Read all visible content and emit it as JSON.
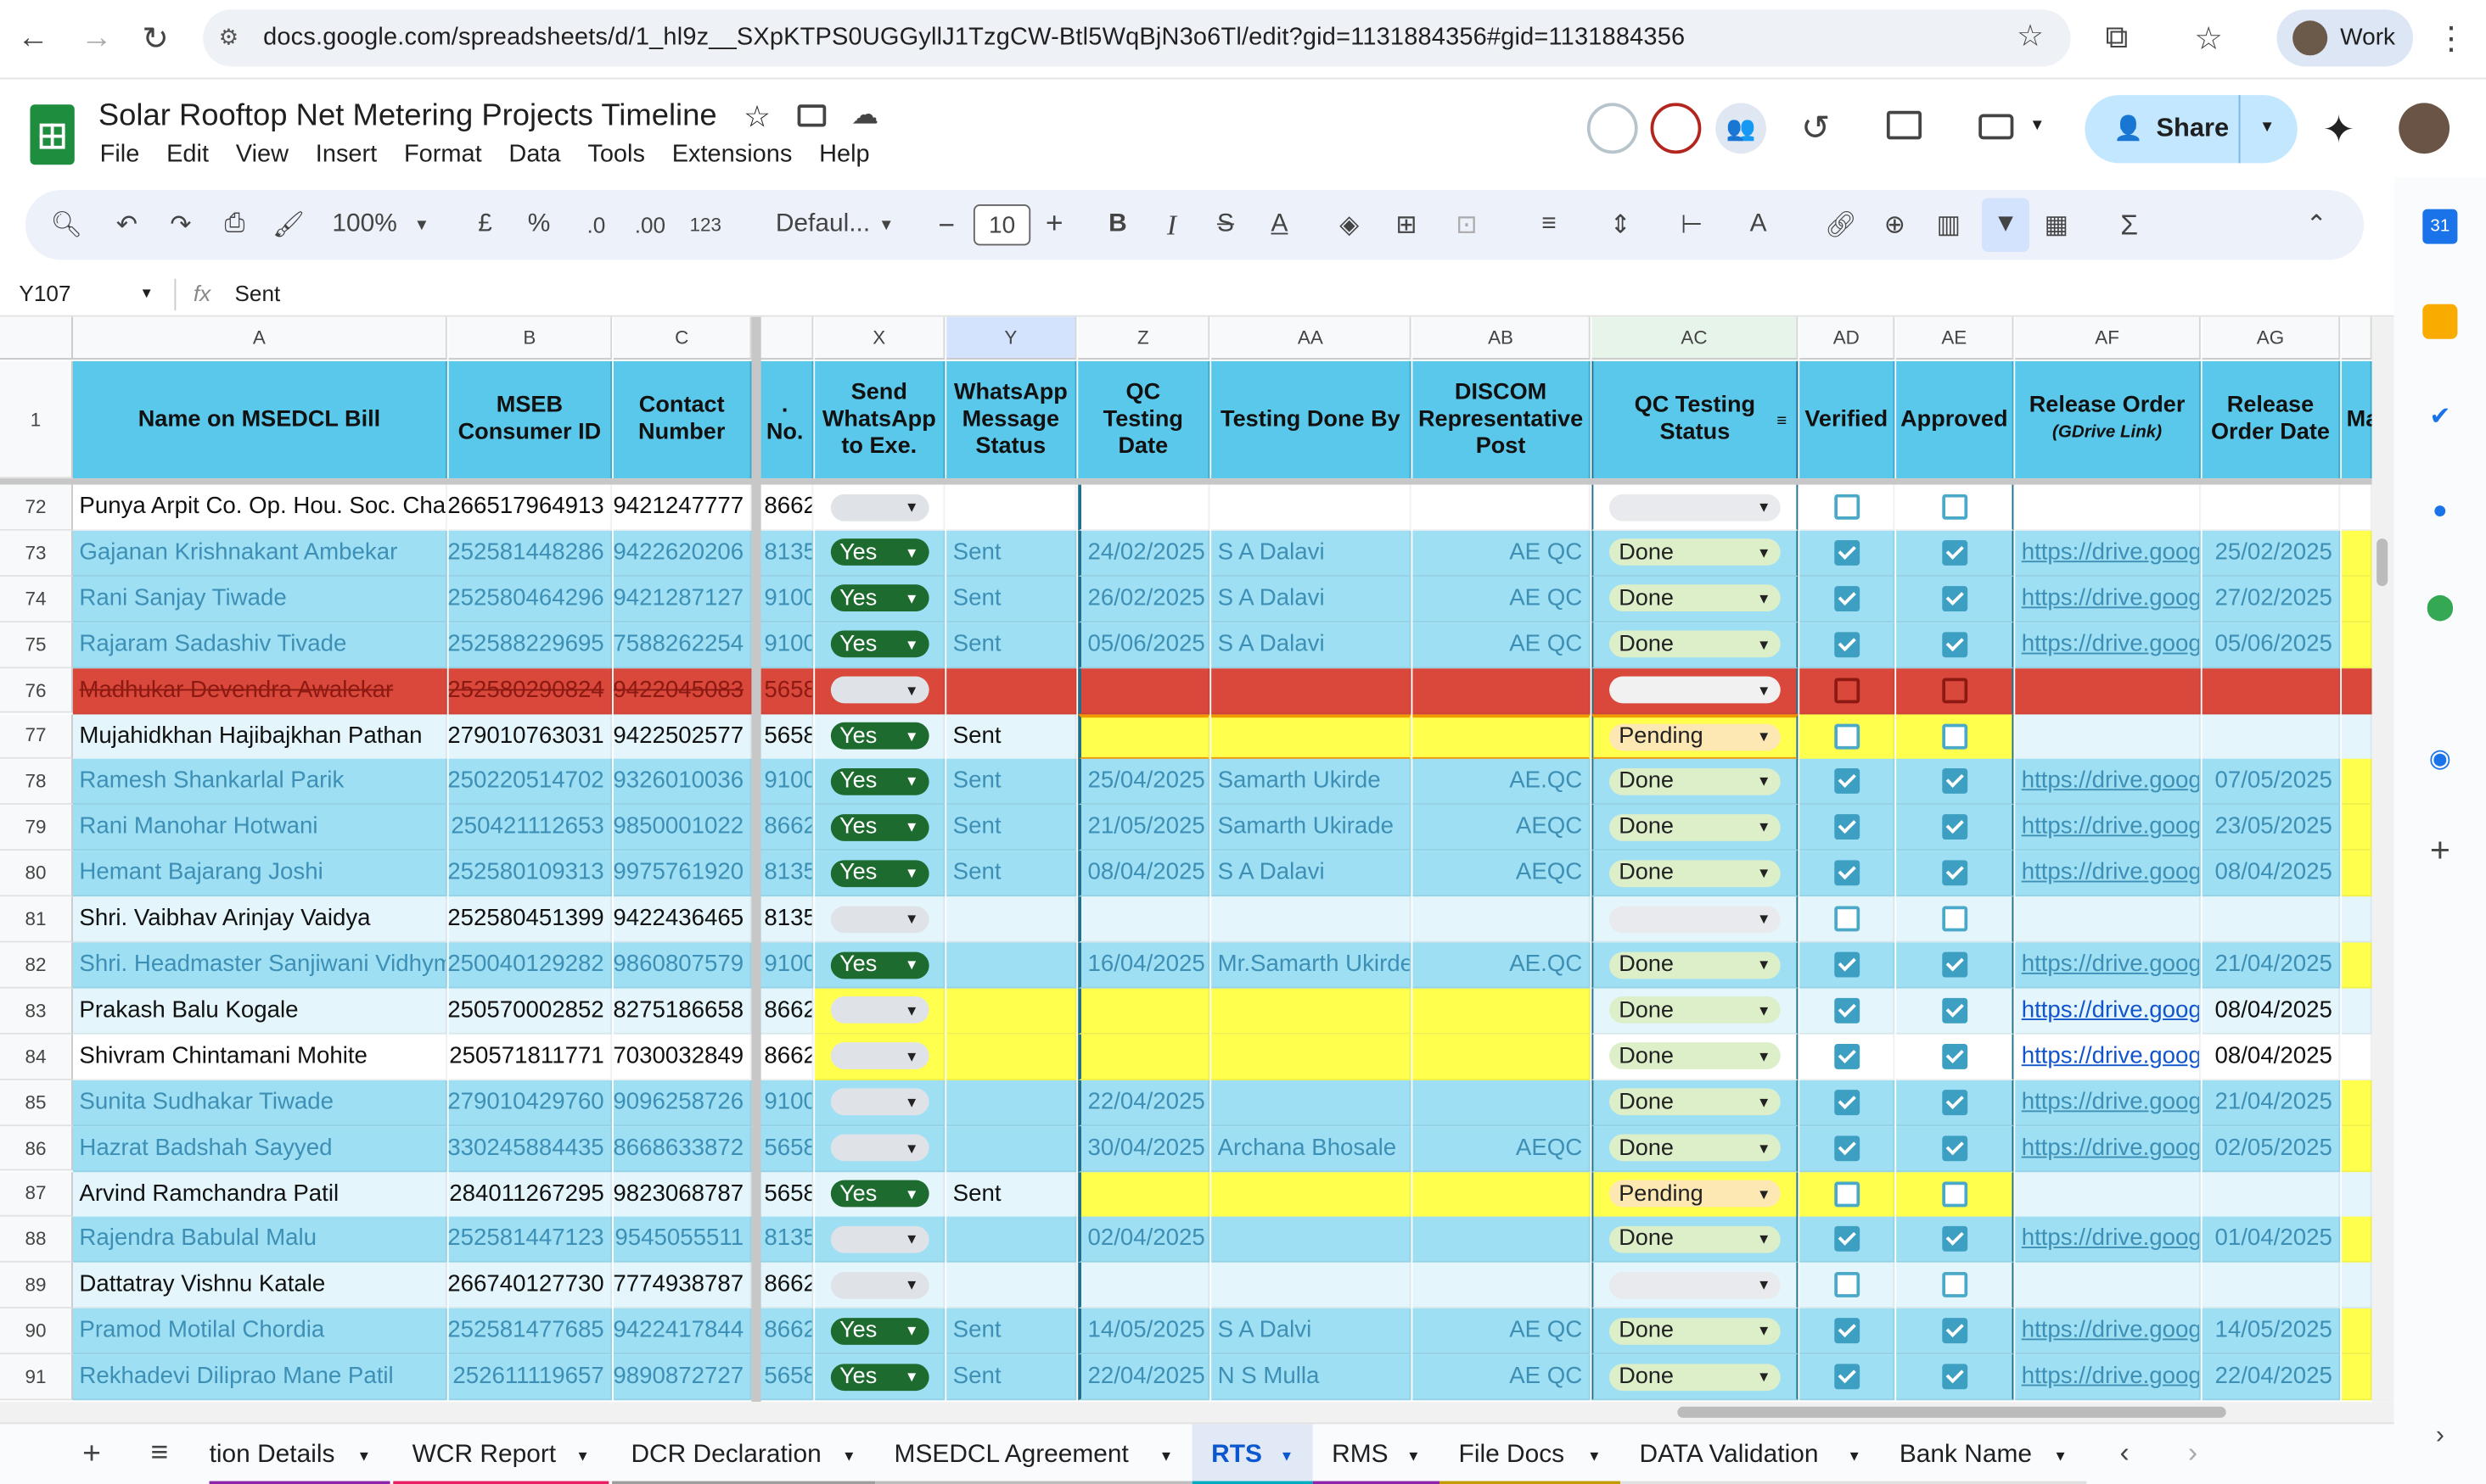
{
  "browser": {
    "url": "docs.google.com/spreadsheets/d/1_hl9z__SXpKTPS0UGGyllJ1TzgCW-Btl5WqBjN3o6Tl/edit?gid=1131884356#gid=1131884356",
    "profile_label": "Work"
  },
  "doc": {
    "title": "Solar Rooftop Net Metering Projects Timeline",
    "menu": [
      "File",
      "Edit",
      "View",
      "Insert",
      "Format",
      "Data",
      "Tools",
      "Extensions",
      "Help"
    ],
    "share_label": "Share"
  },
  "toolbar": {
    "zoom": "100%",
    "currency": "£",
    "percent": "%",
    "dec_decrease": ".0",
    "dec_increase": ".00",
    "format_123": "123",
    "font": "Defaul...",
    "font_size": "10",
    "minus": "−",
    "plus": "+"
  },
  "formula_bar": {
    "name_box": "Y107",
    "fx": "fx",
    "content": "Sent"
  },
  "columns": [
    "A",
    "B",
    "C",
    "X",
    "Y",
    "Z",
    "AA",
    "AB",
    "AC",
    "AD",
    "AE",
    "AF",
    "AG"
  ],
  "headers": {
    "A": "Name on MSEDCL Bill",
    "B": "MSEB Consumer ID",
    "C": "Contact Number",
    "partial": ". No.",
    "X": "Send WhatsApp to Exe.",
    "Y": "WhatsApp Message Status",
    "Z": "QC Testing Date",
    "AA": "Testing Done By",
    "AB": "DISCOM Representative Post",
    "AC": "QC Testing Status",
    "AD": "Verified",
    "AE": "Approved",
    "AF": "Release Order",
    "AF_sub": "(GDrive Link)",
    "AG": "Release Order Date",
    "AH_partial": "Ma"
  },
  "rows": [
    {
      "n": "72",
      "name": "Punya Arpit Co. Op. Hou. Soc. Chair",
      "consumer": "266517964913",
      "contact": "9421247777",
      "sno": "8662",
      "wa": "",
      "wa_status": "",
      "qc_date": "",
      "by": "",
      "post": "",
      "status": "",
      "verified": false,
      "approved": false,
      "link": "",
      "date": ""
    },
    {
      "n": "73",
      "name": "Gajanan Krishnakant Ambekar",
      "consumer": "252581448286",
      "contact": "9422620206",
      "sno": "8135",
      "wa": "Yes",
      "wa_status": "Sent",
      "qc_date": "24/02/2025",
      "by": "S A Dalavi",
      "post": "AE QC",
      "status": "Done",
      "verified": true,
      "approved": true,
      "link": "https://drive.googl",
      "date": "25/02/2025"
    },
    {
      "n": "74",
      "name": "Rani Sanjay Tiwade",
      "consumer": "252580464296",
      "contact": "9421287127",
      "sno": "9100",
      "wa": "Yes",
      "wa_status": "Sent",
      "qc_date": "26/02/2025",
      "by": "S A Dalavi",
      "post": "AE QC",
      "status": "Done",
      "verified": true,
      "approved": true,
      "link": "https://drive.googl",
      "date": "27/02/2025"
    },
    {
      "n": "75",
      "name": "Rajaram Sadashiv Tivade",
      "consumer": "252588229695",
      "contact": "7588262254",
      "sno": "9100",
      "wa": "Yes",
      "wa_status": "Sent",
      "qc_date": "05/06/2025",
      "by": "S A Dalavi",
      "post": "AE QC",
      "status": "Done",
      "verified": true,
      "approved": true,
      "link": "https://drive.googl",
      "date": "05/06/2025"
    },
    {
      "n": "76",
      "name": "Madhukar Devendra Awalekar",
      "consumer": "252580290824",
      "contact": "9422045083",
      "sno": "5658",
      "wa": "",
      "wa_status": "",
      "qc_date": "",
      "by": "",
      "post": "",
      "status": "",
      "verified": false,
      "approved": false,
      "link": "",
      "date": ""
    },
    {
      "n": "77",
      "name": "Mujahidkhan Hajibajkhan Pathan",
      "consumer": "279010763031",
      "contact": "9422502577",
      "sno": "5658",
      "wa": "Yes",
      "wa_status": "Sent",
      "qc_date": "",
      "by": "",
      "post": "",
      "status": "Pending",
      "verified": false,
      "approved": false,
      "link": "",
      "date": ""
    },
    {
      "n": "78",
      "name": "Ramesh Shankarlal Parik",
      "consumer": "250220514702",
      "contact": "9326010036",
      "sno": "9100",
      "wa": "Yes",
      "wa_status": "Sent",
      "qc_date": "25/04/2025",
      "by": "Samarth Ukirde",
      "post": "AE.QC",
      "status": "Done",
      "verified": true,
      "approved": true,
      "link": "https://drive.googl",
      "date": "07/05/2025"
    },
    {
      "n": "79",
      "name": "Rani Manohar Hotwani",
      "consumer": "250421112653",
      "contact": "9850001022",
      "sno": "8662",
      "wa": "Yes",
      "wa_status": "Sent",
      "qc_date": "21/05/2025",
      "by": "Samarth Ukirade",
      "post": "AEQC",
      "status": "Done",
      "verified": true,
      "approved": true,
      "link": "https://drive.googl",
      "date": "23/05/2025"
    },
    {
      "n": "80",
      "name": "Hemant Bajarang Joshi",
      "consumer": "252580109313",
      "contact": "9975761920",
      "sno": "8135",
      "wa": "Yes",
      "wa_status": "Sent",
      "qc_date": "08/04/2025",
      "by": "S A Dalavi",
      "post": "AEQC",
      "status": "Done",
      "verified": true,
      "approved": true,
      "link": "https://drive.googl",
      "date": "08/04/2025"
    },
    {
      "n": "81",
      "name": "Shri. Vaibhav Arinjay Vaidya",
      "consumer": "252580451399",
      "contact": "9422436465",
      "sno": "8135",
      "wa": "",
      "wa_status": "",
      "qc_date": "",
      "by": "",
      "post": "",
      "status": "",
      "verified": false,
      "approved": false,
      "link": "",
      "date": ""
    },
    {
      "n": "82",
      "name": "Shri. Headmaster Sanjiwani Vidhyma",
      "consumer": "250040129282",
      "contact": "9860807579",
      "sno": "9100",
      "wa": "Yes",
      "wa_status": "",
      "qc_date": "16/04/2025",
      "by": "Mr.Samarth Ukirde",
      "post": "AE.QC",
      "status": "Done",
      "verified": true,
      "approved": true,
      "link": "https://drive.googl",
      "date": "21/04/2025"
    },
    {
      "n": "83",
      "name": "Prakash Balu Kogale",
      "consumer": "250570002852",
      "contact": "8275186658",
      "sno": "8662",
      "wa": "",
      "wa_status": "",
      "qc_date": "",
      "by": "",
      "post": "",
      "status": "Done",
      "verified": true,
      "approved": true,
      "link": "https://drive.googl",
      "date": "08/04/2025"
    },
    {
      "n": "84",
      "name": "Shivram Chintamani Mohite",
      "consumer": "250571811771",
      "contact": "7030032849",
      "sno": "8662",
      "wa": "",
      "wa_status": "",
      "qc_date": "",
      "by": "",
      "post": "",
      "status": "Done",
      "verified": true,
      "approved": true,
      "link": "https://drive.googl",
      "date": "08/04/2025"
    },
    {
      "n": "85",
      "name": "Sunita Sudhakar Tiwade",
      "consumer": "279010429760",
      "contact": "9096258726",
      "sno": "9100",
      "wa": "",
      "wa_status": "",
      "qc_date": "22/04/2025",
      "by": "",
      "post": "",
      "status": "Done",
      "verified": true,
      "approved": true,
      "link": "https://drive.googl",
      "date": "21/04/2025"
    },
    {
      "n": "86",
      "name": "Hazrat Badshah Sayyed",
      "consumer": "330245884435",
      "contact": "8668633872",
      "sno": "5658",
      "wa": "",
      "wa_status": "",
      "qc_date": "30/04/2025",
      "by": "Archana Bhosale",
      "post": "AEQC",
      "status": "Done",
      "verified": true,
      "approved": true,
      "link": "https://drive.googl",
      "date": "02/05/2025"
    },
    {
      "n": "87",
      "name": "Arvind Ramchandra Patil",
      "consumer": "284011267295",
      "contact": "9823068787",
      "sno": "5658",
      "wa": "Yes",
      "wa_status": "Sent",
      "qc_date": "",
      "by": "",
      "post": "",
      "status": "Pending",
      "verified": false,
      "approved": false,
      "link": "",
      "date": ""
    },
    {
      "n": "88",
      "name": "Rajendra Babulal Malu",
      "consumer": "252581447123",
      "contact": "9545055511",
      "sno": "8135",
      "wa": "",
      "wa_status": "",
      "qc_date": "02/04/2025",
      "by": "",
      "post": "",
      "status": "Done",
      "verified": true,
      "approved": true,
      "link": "https://drive.googl",
      "date": "01/04/2025"
    },
    {
      "n": "89",
      "name": "Dattatray Vishnu Katale",
      "consumer": "266740127730",
      "contact": "7774938787",
      "sno": "8662",
      "wa": "",
      "wa_status": "",
      "qc_date": "",
      "by": "",
      "post": "",
      "status": "",
      "verified": false,
      "approved": false,
      "link": "",
      "date": ""
    },
    {
      "n": "90",
      "name": "Pramod Motilal Chordia",
      "consumer": "252581477685",
      "contact": "9422417844",
      "sno": "8662",
      "wa": "Yes",
      "wa_status": "Sent",
      "qc_date": "14/05/2025",
      "by": "S A Dalvi",
      "post": "AE QC",
      "status": "Done",
      "verified": true,
      "approved": true,
      "link": "https://drive.googl",
      "date": "14/05/2025"
    },
    {
      "n": "91",
      "name": "Rekhadevi Diliprao Mane Patil",
      "consumer": "252611119657",
      "contact": "9890872727",
      "sno": "5658",
      "wa": "Yes",
      "wa_status": "Sent",
      "qc_date": "22/04/2025",
      "by": "N S Mulla",
      "post": "AE QC",
      "status": "Done",
      "verified": true,
      "approved": true,
      "link": "https://drive.googl",
      "date": "22/04/2025"
    }
  ],
  "sheet_tabs": [
    "tion Details",
    "WCR Report",
    "DCR Declaration",
    "MSEDCL Agreement",
    "RTS",
    "RMS",
    "File Docs",
    "DATA Validation",
    "Bank Name"
  ],
  "active_tab": "RTS",
  "colors": {
    "header_blue": "#5ac8ea",
    "row_blue": "#9edff3",
    "row_light": "#e4f6fc",
    "row_white": "#ffffff",
    "row_red": "#d9483b",
    "highlight_yellow": "#ffff4d",
    "chip_yes": "#1e6b2f",
    "chip_done": "#dcefc9",
    "chip_pending": "#fde8b3",
    "link": "#1155cc"
  }
}
